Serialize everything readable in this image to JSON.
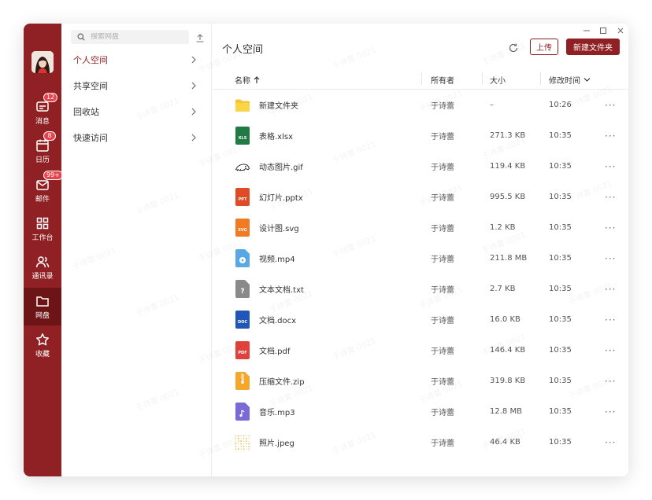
{
  "rail": {
    "items": [
      {
        "label": "消息",
        "badge": "12",
        "icon": "message-icon"
      },
      {
        "label": "日历",
        "badge": "8",
        "icon": "calendar-icon"
      },
      {
        "label": "邮件",
        "badge": "99+",
        "icon": "mail-icon"
      },
      {
        "label": "工作台",
        "badge": "",
        "icon": "grid-icon"
      },
      {
        "label": "通讯录",
        "badge": "",
        "icon": "contacts-icon"
      },
      {
        "label": "网盘",
        "badge": "",
        "icon": "folder-icon"
      },
      {
        "label": "收藏",
        "badge": "",
        "icon": "star-icon"
      }
    ],
    "active": "网盘"
  },
  "sidebar": {
    "search_placeholder": "搜索网盘",
    "items": [
      {
        "label": "个人空间"
      },
      {
        "label": "共享空间"
      },
      {
        "label": "回收站"
      },
      {
        "label": "快速访问"
      }
    ]
  },
  "main": {
    "title": "个人空间",
    "upload_label": "上传",
    "new_folder_label": "新建文件夹",
    "columns": {
      "name": "名称",
      "owner": "所有者",
      "size": "大小",
      "modified": "修改时间"
    },
    "rows": [
      {
        "name": "新建文件夹",
        "owner": "于诗蕾",
        "size": "–",
        "time": "10:26",
        "type": "folder"
      },
      {
        "name": "表格.xlsx",
        "owner": "于诗蕾",
        "size": "271.3 KB",
        "time": "10:35",
        "type": "xls"
      },
      {
        "name": "动态图片.gif",
        "owner": "于诗蕾",
        "size": "119.4 KB",
        "time": "10:35",
        "type": "gif"
      },
      {
        "name": "幻灯片.pptx",
        "owner": "于诗蕾",
        "size": "995.5 KB",
        "time": "10:35",
        "type": "ppt"
      },
      {
        "name": "设计图.svg",
        "owner": "于诗蕾",
        "size": "1.2 KB",
        "time": "10:35",
        "type": "svg"
      },
      {
        "name": "视频.mp4",
        "owner": "于诗蕾",
        "size": "211.8 MB",
        "time": "10:35",
        "type": "mp4"
      },
      {
        "name": "文本文档.txt",
        "owner": "于诗蕾",
        "size": "2.7 KB",
        "time": "10:35",
        "type": "txt"
      },
      {
        "name": "文档.docx",
        "owner": "于诗蕾",
        "size": "16.0 KB",
        "time": "10:35",
        "type": "doc"
      },
      {
        "name": "文档.pdf",
        "owner": "于诗蕾",
        "size": "146.4 KB",
        "time": "10:35",
        "type": "pdf"
      },
      {
        "name": "压缩文件.zip",
        "owner": "于诗蕾",
        "size": "319.8 KB",
        "time": "10:35",
        "type": "zip"
      },
      {
        "name": "音乐.mp3",
        "owner": "于诗蕾",
        "size": "12.8 MB",
        "time": "10:35",
        "type": "mp3"
      },
      {
        "name": "照片.jpeg",
        "owner": "于诗蕾",
        "size": "46.4 KB",
        "time": "10:35",
        "type": "jpeg"
      }
    ],
    "more_label": "···"
  },
  "watermark": "于诗蕾 0021",
  "colors": {
    "brand": "#8f2024",
    "brand_dark": "#6d1417",
    "badge": "#e8434c"
  }
}
